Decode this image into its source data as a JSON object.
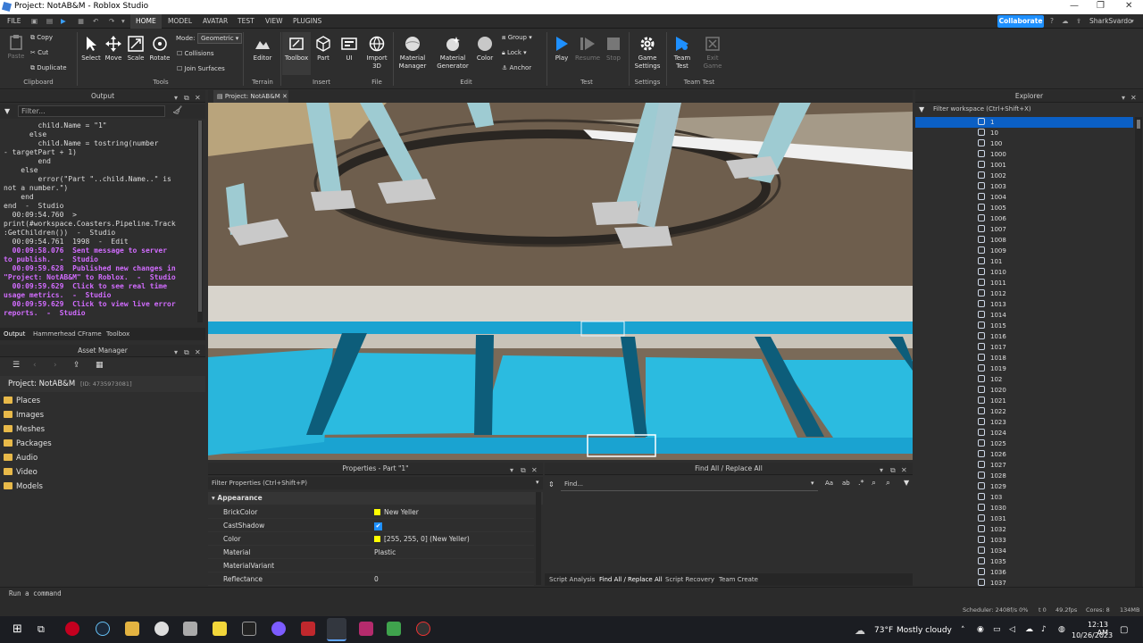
{
  "window": {
    "title": "Project: NotAB&M - Roblox Studio"
  },
  "menu": {
    "file": "FILE",
    "tabs": [
      "HOME",
      "MODEL",
      "AVATAR",
      "TEST",
      "VIEW",
      "PLUGINS"
    ],
    "collaborate": "Collaborate",
    "user": "SharkSvardo"
  },
  "ribbon": {
    "clipboard": {
      "paste": "Paste",
      "copy": "Copy",
      "cut": "Cut",
      "duplicate": "Duplicate",
      "label": "Clipboard"
    },
    "tools": {
      "select": "Select",
      "move": "Move",
      "scale": "Scale",
      "rotate": "Rotate",
      "mode_label": "Mode:",
      "mode_value": "Geometric",
      "collisions": "Collisions",
      "join_surfaces": "Join Surfaces",
      "label": "Tools"
    },
    "terrain": {
      "editor": "Editor",
      "label": "Terrain"
    },
    "insert": {
      "toolbox": "Toolbox",
      "part": "Part",
      "ui": "UI",
      "label": "Insert"
    },
    "file": {
      "import3d": "Import 3D",
      "label": "File"
    },
    "edit": {
      "material_manager": "Material Manager",
      "material_generator": "Material Generator",
      "color": "Color",
      "group": "Group",
      "lock": "Lock",
      "anchor": "Anchor",
      "label": "Edit"
    },
    "test": {
      "play": "Play",
      "resume": "Resume",
      "stop": "Stop",
      "label": "Test"
    },
    "settings": {
      "game_settings": "Game Settings",
      "label": "Settings"
    },
    "team_test": {
      "team_test": "Team Test",
      "exit_game": "Exit Game",
      "label": "Team Test"
    }
  },
  "output": {
    "title": "Output",
    "filter_placeholder": "Filter...",
    "lines": [
      {
        "t": "        child.Name = \"1\"",
        "c": "n"
      },
      {
        "t": "      else",
        "c": "n"
      },
      {
        "t": "        child.Name = tostring(number",
        "c": "n"
      },
      {
        "t": "- targetPart + 1)",
        "c": "n"
      },
      {
        "t": "        end",
        "c": "n"
      },
      {
        "t": "    else",
        "c": "n"
      },
      {
        "t": "        error(\"Part \"..child.Name..\" is",
        "c": "n"
      },
      {
        "t": "not a number.\")",
        "c": "n"
      },
      {
        "t": "    end",
        "c": "n"
      },
      {
        "t": "end  -  Studio",
        "c": "n"
      },
      {
        "t": "  00:09:54.760  >",
        "c": "n"
      },
      {
        "t": "print(#workspace.Coasters.Pipeline.Track",
        "c": "n"
      },
      {
        "t": ":GetChildren())  -  Studio",
        "c": "n"
      },
      {
        "t": "  00:09:54.761  1998  -  Edit",
        "c": "n"
      },
      {
        "t": "  00:09:58.076  Sent message to server",
        "c": "p"
      },
      {
        "t": "to publish.  -  Studio",
        "c": "p"
      },
      {
        "t": "  00:09:59.628  Published new changes in",
        "c": "p"
      },
      {
        "t": "\"Project: NotAB&M\" to Roblox.  -  Studio",
        "c": "p"
      },
      {
        "t": "  00:09:59.629  Click to see real time",
        "c": "p"
      },
      {
        "t": "usage metrics.  -  Studio",
        "c": "p"
      },
      {
        "t": "  00:09:59.629  Click to view live error",
        "c": "p"
      },
      {
        "t": "reports.  -  Studio",
        "c": "p"
      }
    ],
    "tabs": [
      "Output",
      "Hammerhead CFrame",
      "Toolbox"
    ]
  },
  "asset_manager": {
    "title": "Asset Manager",
    "project": "Project: NotAB&M",
    "id": "[ID: 4735973081]",
    "items": [
      "Places",
      "Images",
      "Meshes",
      "Packages",
      "Audio",
      "Video",
      "Models"
    ]
  },
  "viewport": {
    "tab": "Project: NotAB&M"
  },
  "properties": {
    "title": "Properties - Part \"1\"",
    "filter": "Filter Properties (Ctrl+Shift+P)",
    "section": "Appearance",
    "rows": [
      {
        "name": "BrickColor",
        "value": "New Yeller",
        "swatch": "#ffff00"
      },
      {
        "name": "CastShadow",
        "value": "",
        "check": true
      },
      {
        "name": "Color",
        "value": "[255, 255, 0] (New Yeller)",
        "swatch": "#ffff00"
      },
      {
        "name": "Material",
        "value": "Plastic"
      },
      {
        "name": "MaterialVariant",
        "value": ""
      },
      {
        "name": "Reflectance",
        "value": "0"
      }
    ]
  },
  "findall": {
    "title": "Find All / Replace All",
    "placeholder": "Find...",
    "tabs": [
      "Script Analysis",
      "Find All / Replace All",
      "Script Recovery",
      "Team Create"
    ]
  },
  "explorer": {
    "title": "Explorer",
    "filter": "Filter workspace (Ctrl+Shift+X)",
    "items": [
      "1",
      "10",
      "100",
      "1000",
      "1001",
      "1002",
      "1003",
      "1004",
      "1005",
      "1006",
      "1007",
      "1008",
      "1009",
      "101",
      "1010",
      "1011",
      "1012",
      "1013",
      "1014",
      "1015",
      "1016",
      "1017",
      "1018",
      "1019",
      "102",
      "1020",
      "1021",
      "1022",
      "1023",
      "1024",
      "1025",
      "1026",
      "1027",
      "1028",
      "1029",
      "103",
      "1030",
      "1031",
      "1032",
      "1033",
      "1034",
      "1035",
      "1036",
      "1037"
    ]
  },
  "command": {
    "placeholder": "Run a command"
  },
  "statusbar": {
    "scheduler": "Scheduler: 2408f/s 0%",
    "t": "t 0",
    "fps": "49.2fps",
    "cores": "Cores: 8",
    "mem": "134MB"
  },
  "taskbar": {
    "weather_temp": "73°F",
    "weather_text": "Mostly cloudy",
    "time": "12:13 AM",
    "date": "10/26/2023"
  }
}
